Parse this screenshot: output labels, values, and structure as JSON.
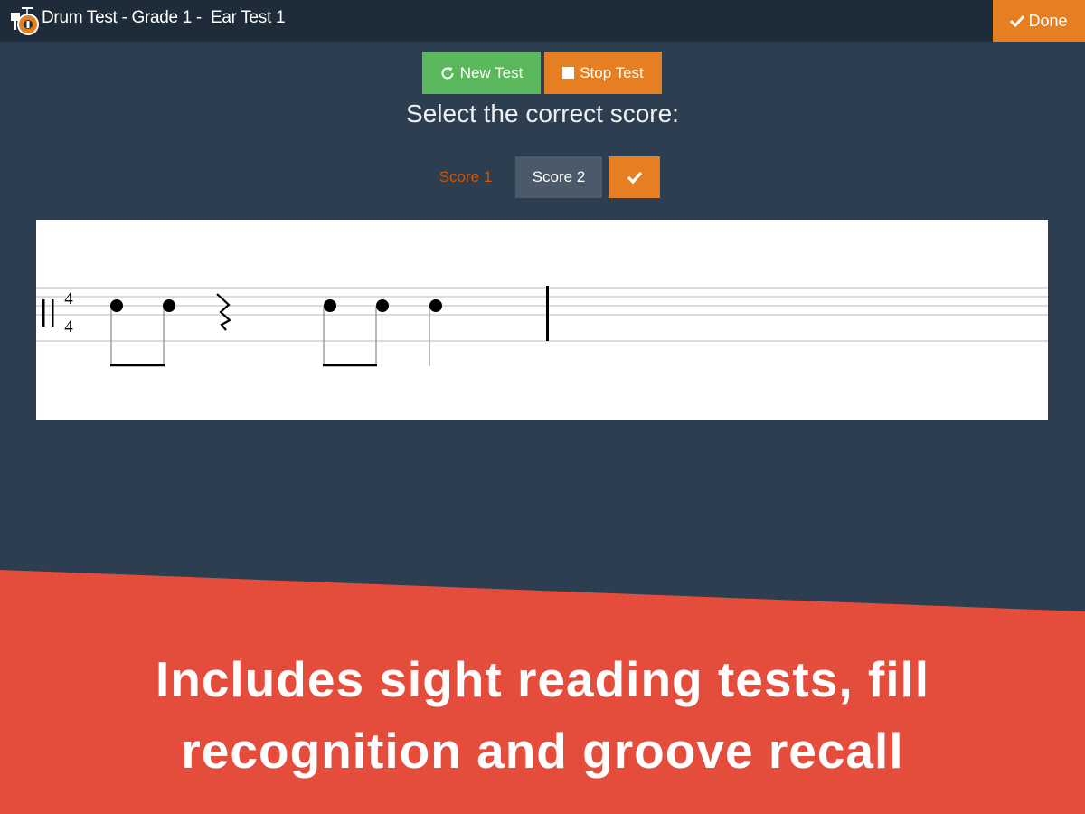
{
  "window": {
    "title": "Drum Test - Grade 1 -  Ear Test 1",
    "logo_icon": "drum-kit-icon"
  },
  "header": {
    "done_label": "Done",
    "done_icon": "checkmark-icon"
  },
  "toolbar": {
    "new_test_label": "New Test",
    "new_test_icon": "refresh-icon",
    "stop_test_label": "Stop Test",
    "stop_test_icon": "stop-square-icon"
  },
  "prompt": "Select the correct score:",
  "scores": {
    "score1_label": "Score 1",
    "score2_label": "Score 2",
    "confirm_icon": "checkmark-icon"
  },
  "notation": {
    "time_signature": {
      "top": "4",
      "bottom": "4"
    }
  },
  "banner": {
    "line1": "Includes sight reading tests, fill",
    "line2": "recognition and groove recall"
  },
  "colors": {
    "background": "#2c3e50",
    "titlebar": "#1e2b38",
    "accent": "#e67e22",
    "green": "#5cb85c",
    "banner": "#e44c3c",
    "score2_bg": "#4a5a6a"
  }
}
